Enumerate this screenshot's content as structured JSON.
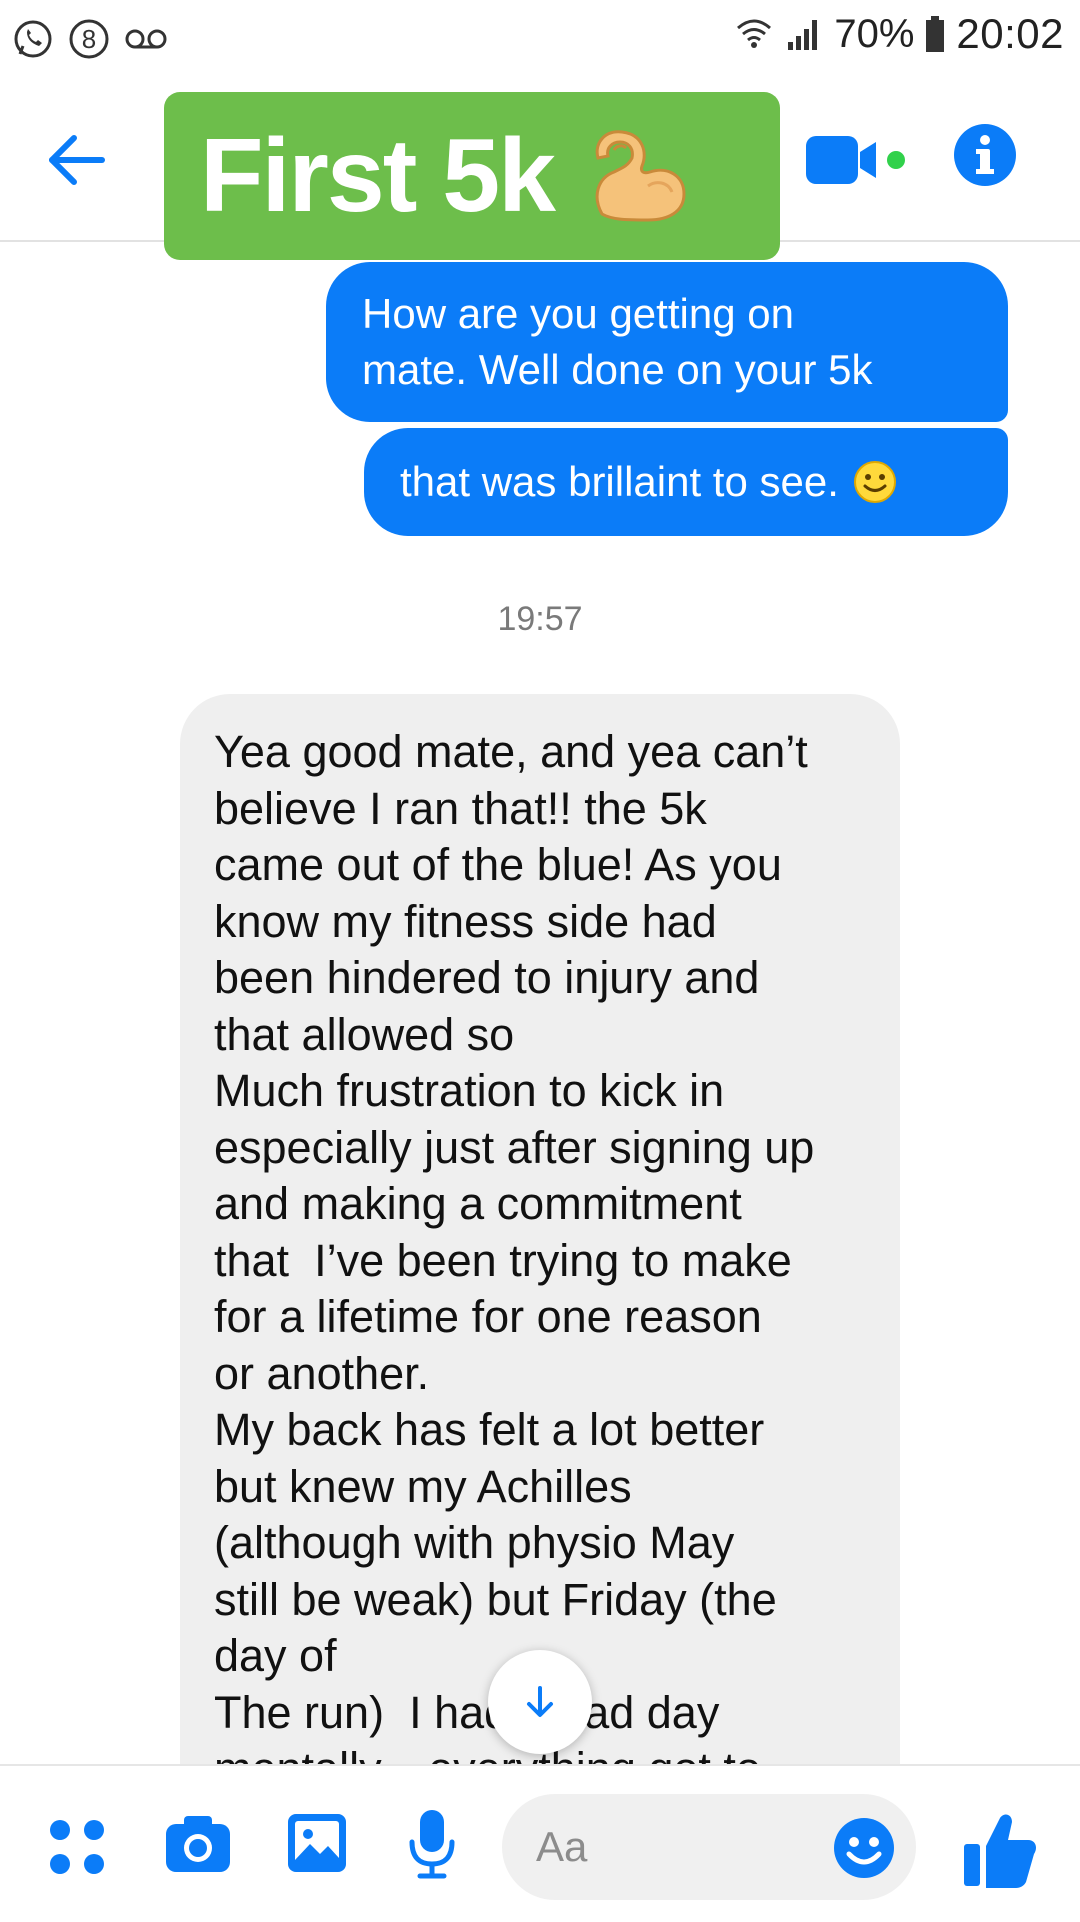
{
  "status_bar": {
    "battery": "70%",
    "time": "20:02",
    "left_icons": [
      "whatsapp-icon",
      "notification-count-icon",
      "voicemail-icon"
    ],
    "notification_count": "8",
    "right_icons": [
      "wifi-icon",
      "signal-icon",
      "battery-icon"
    ]
  },
  "header": {
    "title": "First 5k",
    "title_emoji": "flexed-biceps-icon",
    "back_icon": "back-arrow-icon",
    "video_icon": "video-call-icon",
    "info_icon": "info-icon",
    "colors": {
      "accent": "#0b7cf8",
      "title_badge": "#6dbe4b",
      "online_dot": "#31d14b"
    }
  },
  "messages": {
    "outgoing": [
      {
        "lines": [
          "How are you getting on",
          "mate. Well done on your 5k"
        ]
      },
      {
        "text": "that was brillaint to see.",
        "emoji": "smiley-icon"
      }
    ],
    "timestamp": "19:57",
    "incoming": {
      "lines": [
        "Yea good mate, and yea can’t",
        "believe I ran that!! the 5k",
        "came out of the blue! As you",
        "know my fitness side had",
        "been hindered to injury and",
        "that allowed so",
        "Much frustration to kick in",
        "especially just after signing up",
        "and making a commitment",
        "that  I’ve been trying to make",
        "for a lifetime for one reason",
        "or another.",
        "My back has felt a lot better",
        "but knew my Achilles",
        "(although with physio May",
        "still be weak) but Friday (the",
        "day of",
        "The run)  I had a bad day",
        "mentally... everything got to"
      ]
    }
  },
  "composer": {
    "placeholder": "Aa",
    "icons": [
      "more-options-icon",
      "camera-icon",
      "gallery-icon",
      "microphone-icon",
      "emoji-icon",
      "like-icon"
    ]
  }
}
